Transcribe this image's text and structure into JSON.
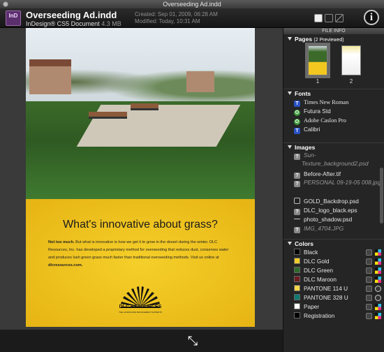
{
  "window": {
    "title": "Overseeding Ad.indd"
  },
  "file": {
    "icon_label": "InD",
    "name": "Overseeding Ad.indd",
    "type": "InDesign® CS5 Document",
    "size": "4.3 MB",
    "created": "Created: Sep 01, 2009, 06:28 AM",
    "modified": "Modified: Today, 10:31 AM"
  },
  "info_button": "i",
  "ad": {
    "headline": "What's innovative about grass?",
    "lead": "Not too much.",
    "body": " But what is innovative is how we get it to grow in the desert during the winter. DLC Resources, Inc. has developed a proprietary method for overseeding that reduces dust, conserves water and produces lush green grass much faster than traditional overseeding methods. Visit us online at ",
    "url": "dlcresources.com.",
    "logo": "DLC RESOURCES",
    "logo_sub": "THE LANDSCAPE MANAGEMENT EXPERTS"
  },
  "panel": {
    "header": "FILE INFO",
    "pages": {
      "title": "Pages",
      "subtitle": "(2 Previewed)",
      "items": [
        "1",
        "2"
      ]
    },
    "fonts": {
      "title": "Fonts",
      "items": [
        {
          "label": "Times New Roman",
          "icon": "truetype-icon"
        },
        {
          "label": "Futura Std",
          "icon": "opentype-icon"
        },
        {
          "label": "Adobe Caslon Pro",
          "icon": "opentype-icon"
        },
        {
          "label": "Calibri",
          "icon": "truetype-icon"
        }
      ]
    },
    "images": {
      "title": "Images",
      "items": [
        {
          "label": "Sun-Texture_background2.psd",
          "missing": true
        },
        {
          "label": "Before-After.tif",
          "missing": false
        },
        {
          "label": "PERSONAL 09-19-05 008.jpg",
          "missing": true
        },
        {
          "label": "GOLD_Backdrop.psd",
          "missing": false
        },
        {
          "label": "DLC_logo_black.eps",
          "missing": false
        },
        {
          "label": "photo_shadow.psd",
          "missing": false
        },
        {
          "label": "IMG_4704.JPG",
          "missing": true
        }
      ]
    },
    "colors": {
      "title": "Colors",
      "items": [
        {
          "label": "Black",
          "swatch": "#000000",
          "spot": false
        },
        {
          "label": "DLC Gold",
          "swatch": "#f3cc2b",
          "spot": false
        },
        {
          "label": "DLC Green",
          "swatch": "#2f6a2d",
          "spot": false
        },
        {
          "label": "DLC Maroon",
          "swatch": "#6e1c20",
          "spot": false
        },
        {
          "label": "PANTONE 114 U",
          "swatch": "#f6d84a",
          "spot": true
        },
        {
          "label": "PANTONE 328 U",
          "swatch": "#0f7a72",
          "spot": true
        },
        {
          "label": "Paper",
          "swatch": "#ffffff",
          "spot": false
        },
        {
          "label": "Registration",
          "swatch": "#000000",
          "spot": false
        }
      ]
    }
  }
}
